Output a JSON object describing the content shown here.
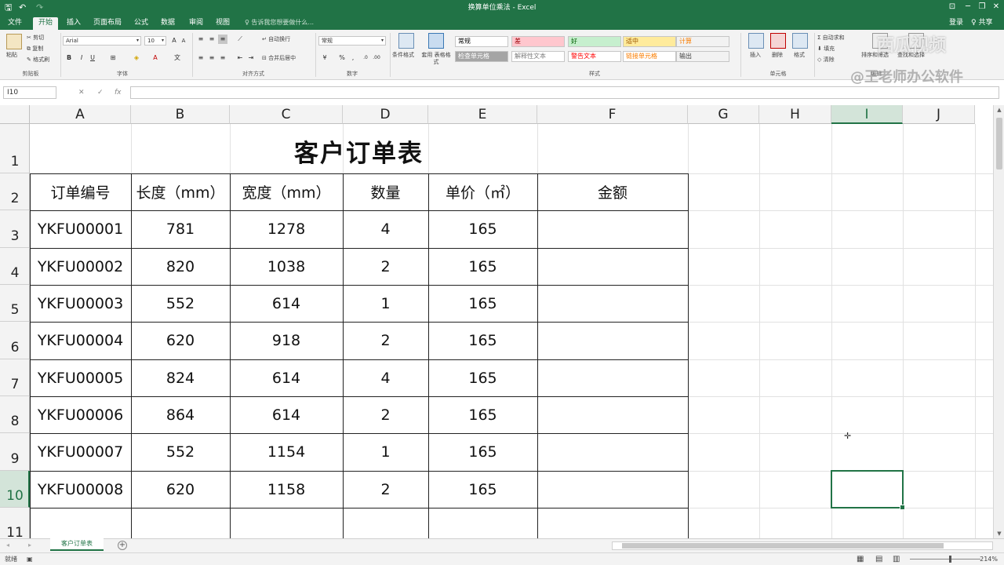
{
  "app": {
    "window_title": "换算单位乘法 - Excel",
    "quick_access": {
      "save": "🖫",
      "undo": "↶",
      "redo": "↷"
    },
    "window_controls": {
      "ribbon_options": "⊡",
      "minimize": "─",
      "restore": "❐",
      "close": "✕"
    }
  },
  "tabs": [
    {
      "label": "文件",
      "active": false
    },
    {
      "label": "开始",
      "active": true
    },
    {
      "label": "插入",
      "active": false
    },
    {
      "label": "页面布局",
      "active": false
    },
    {
      "label": "公式",
      "active": false
    },
    {
      "label": "数据",
      "active": false
    },
    {
      "label": "审阅",
      "active": false
    },
    {
      "label": "视图",
      "active": false
    }
  ],
  "tell_me": "♀ 告诉我您想要做什么...",
  "account": {
    "signin": "登录",
    "share": "♀ 共享"
  },
  "ribbon": {
    "clipboard": {
      "name": "剪贴板",
      "paste": "粘贴",
      "cut": "剪切",
      "copy": "复制",
      "format_painter": "格式刷"
    },
    "font": {
      "name": "字体",
      "font_family": "Arial",
      "font_size": "10",
      "bold": "B",
      "italic": "I",
      "underline": "U"
    },
    "alignment": {
      "name": "对齐方式",
      "wrap": "自动换行",
      "merge": "合并后居中"
    },
    "number": {
      "name": "数字",
      "format": "常规",
      "percent": "%",
      "comma": ","
    },
    "styles": {
      "name": "样式",
      "conditional": "条件格式",
      "table_format": "套用 表格格式",
      "cells": [
        {
          "label": "常规",
          "bg": "#ffffff",
          "fg": "#000000"
        },
        {
          "label": "差",
          "bg": "#ffc7ce",
          "fg": "#9c0006"
        },
        {
          "label": "好",
          "bg": "#c6efce",
          "fg": "#006100"
        },
        {
          "label": "适中",
          "bg": "#ffeb9c",
          "fg": "#9c5700"
        },
        {
          "label": "计算",
          "bg": "#f2f2f2",
          "fg": "#fa7d00"
        },
        {
          "label": "检查单元格",
          "bg": "#a5a5a5",
          "fg": "#ffffff"
        },
        {
          "label": "解释性文本",
          "bg": "#ffffff",
          "fg": "#7f7f7f"
        },
        {
          "label": "警告文本",
          "bg": "#ffffff",
          "fg": "#ff0000"
        },
        {
          "label": "链接单元格",
          "bg": "#ffffff",
          "fg": "#fa7d00"
        },
        {
          "label": "输出",
          "bg": "#f2f2f2",
          "fg": "#3f3f3f"
        }
      ]
    },
    "cells_group": {
      "name": "单元格",
      "insert": "插入",
      "delete": "删除",
      "format": "格式"
    },
    "editing": {
      "name": "编辑",
      "autosum": "自动求和",
      "fill": "填充",
      "clear": "清除",
      "sort_filter": "排序和筛选",
      "find_select": "查找和选择"
    }
  },
  "formula_bar": {
    "name_box": "I10",
    "cancel": "✕",
    "enter": "✓",
    "fx": "fx",
    "value": ""
  },
  "grid": {
    "columns": [
      "A",
      "B",
      "C",
      "D",
      "E",
      "F",
      "G",
      "H",
      "I",
      "J"
    ],
    "rows": [
      "1",
      "2",
      "3",
      "4",
      "5",
      "6",
      "7",
      "8",
      "9",
      "10",
      "11"
    ],
    "selected_column": "I",
    "selected_row": "10",
    "title": "客户订单表",
    "headers": [
      "订单编号",
      "长度（mm）",
      "宽度（mm）",
      "数量",
      "单价（㎡）",
      "金额"
    ],
    "records": [
      [
        "YKFU00001",
        "781",
        "1278",
        "4",
        "165",
        ""
      ],
      [
        "YKFU00002",
        "820",
        "1038",
        "2",
        "165",
        ""
      ],
      [
        "YKFU00003",
        "552",
        "614",
        "1",
        "165",
        ""
      ],
      [
        "YKFU00004",
        "620",
        "918",
        "2",
        "165",
        ""
      ],
      [
        "YKFU00005",
        "824",
        "614",
        "4",
        "165",
        ""
      ],
      [
        "YKFU00006",
        "864",
        "614",
        "2",
        "165",
        ""
      ],
      [
        "YKFU00007",
        "552",
        "1154",
        "1",
        "165",
        ""
      ],
      [
        "YKFU00008",
        "620",
        "1158",
        "2",
        "165",
        ""
      ]
    ]
  },
  "sheet_tabs": [
    {
      "label": "客户订单表",
      "active": true
    }
  ],
  "add_sheet": "+",
  "status": {
    "ready": "就绪",
    "zoom": "214%"
  },
  "watermarks": [
    "西瓜视频",
    "@王老师办公软件"
  ]
}
